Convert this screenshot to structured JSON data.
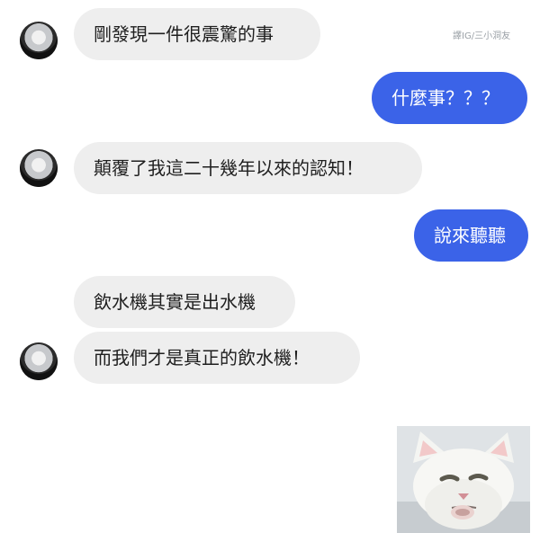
{
  "watermark": "譯IG/三小洞友",
  "messages": [
    {
      "side": "in",
      "text": "剛發現一件很震驚的事"
    },
    {
      "side": "out",
      "text": "什麼事？？？"
    },
    {
      "side": "in",
      "text": "顛覆了我這二十幾年以來的認知！"
    },
    {
      "side": "out",
      "text": "說來聽聽"
    },
    {
      "side": "in",
      "text": "飲水機其實是出水機"
    },
    {
      "side": "in",
      "text": "而我們才是真正的飲水機！"
    }
  ],
  "colors": {
    "incoming_bg": "#eeeeee",
    "outgoing_bg": "#3b63e8",
    "outgoing_text": "#ffffff"
  },
  "sticker": {
    "icon": "white-cat-sticker"
  }
}
